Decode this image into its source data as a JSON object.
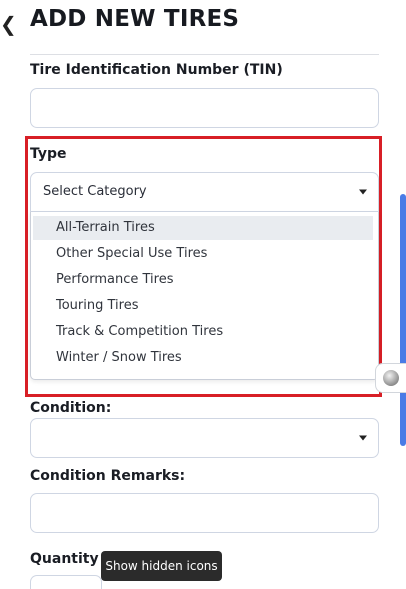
{
  "header": {
    "back_icon": "chevron-left-icon",
    "title": "ADD NEW TIRES"
  },
  "form": {
    "tin_label": "Tire Identification Number (TIN)",
    "tin_value": "",
    "type_label": "Type",
    "type_selected": "Select Category",
    "type_options": [
      "All-Terrain Tires",
      "Other Special Use Tires",
      "Performance Tires",
      "Touring Tires",
      "Track & Competition Tires",
      "Winter / Snow Tires"
    ],
    "condition_label": "Condition:",
    "condition_selected": "",
    "condition_remarks_label": "Condition Remarks:",
    "condition_remarks_value": "",
    "quantity_label": "Quantity"
  },
  "tooltip": {
    "text": "Show hidden icons"
  },
  "colors": {
    "highlight": "#d81f26",
    "scrollbar": "#4a7be6",
    "active_option": "#e9ecf0"
  }
}
